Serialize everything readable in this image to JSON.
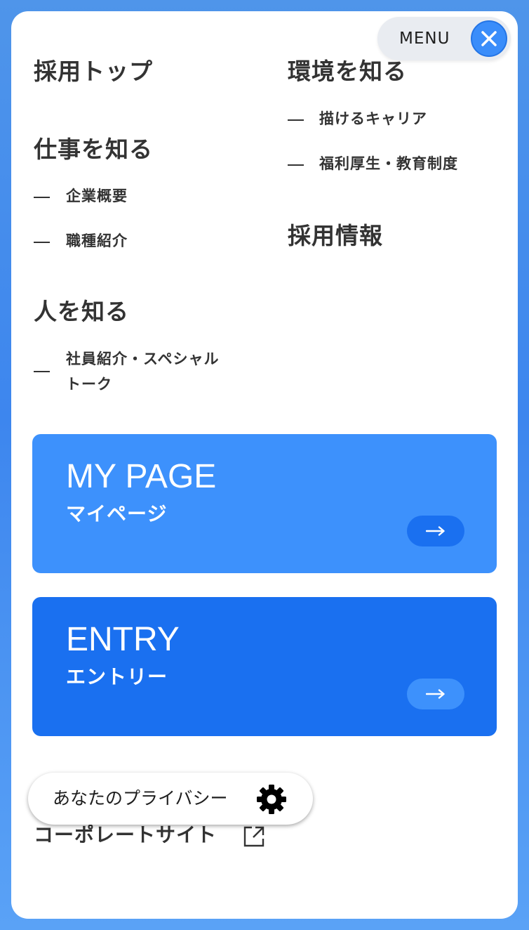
{
  "header": {
    "menu_label": "MENU",
    "close_icon": "close-icon"
  },
  "nav": {
    "left": {
      "recruit_top": "採用トップ",
      "work": {
        "title": "仕事を知る",
        "items": [
          "企業概要",
          "職種紹介"
        ]
      },
      "people": {
        "title": "人を知る",
        "items": [
          "社員紹介・スペシャルトーク"
        ],
        "item_lines": [
          "社員紹介・スペシャル",
          "トーク"
        ]
      }
    },
    "right": {
      "environment": {
        "title": "環境を知る",
        "items": [
          "描けるキャリア",
          "福利厚生・教育制度"
        ]
      },
      "recruit_info": "採用情報"
    }
  },
  "cards": {
    "mypage": {
      "title": "MY PAGE",
      "subtitle": "マイページ",
      "bg": "#3d91fc",
      "button_bg": "#1a70f0",
      "icon": "arrow-right-icon"
    },
    "entry": {
      "title": "ENTRY",
      "subtitle": "エントリー",
      "bg": "#1a70f0",
      "button_bg": "#3d91fc",
      "icon": "arrow-right-icon"
    }
  },
  "privacy": {
    "label": "あなたのプライバシー",
    "icon": "gear-icon"
  },
  "footer": {
    "corporate_site": "コーポレートサイト",
    "icon": "external-link-icon"
  },
  "colors": {
    "accent": "#3a8dfa",
    "text": "#333333",
    "background": "#4f95ea"
  }
}
